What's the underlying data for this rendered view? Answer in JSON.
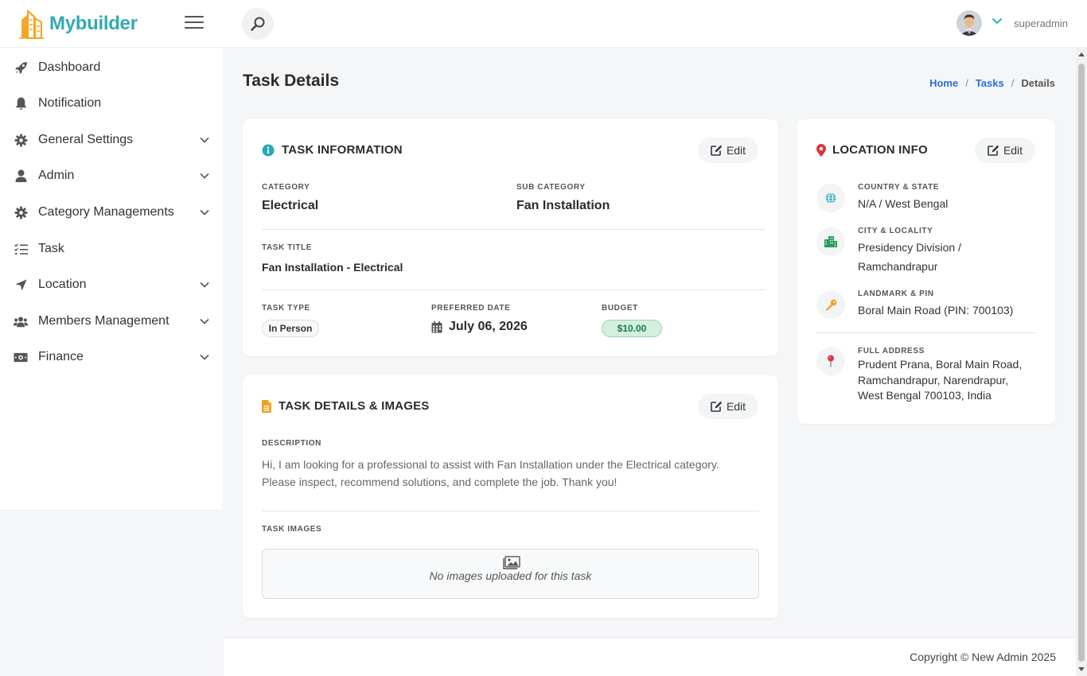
{
  "app": {
    "name": "Mybuilder"
  },
  "header": {
    "user_name": "superadmin"
  },
  "sidebar": {
    "items": [
      {
        "label": "Dashboard",
        "icon": "rocket-icon",
        "expandable": false
      },
      {
        "label": "Notification",
        "icon": "bell-icon",
        "expandable": false
      },
      {
        "label": "General Settings",
        "icon": "gear-icon",
        "expandable": true
      },
      {
        "label": "Admin",
        "icon": "user-icon",
        "expandable": true
      },
      {
        "label": "Category Managements",
        "icon": "gear-icon",
        "expandable": true
      },
      {
        "label": "Task",
        "icon": "task-list-icon",
        "expandable": false
      },
      {
        "label": "Location",
        "icon": "location-arrow-icon",
        "expandable": true
      },
      {
        "label": "Members Management",
        "icon": "users-icon",
        "expandable": true
      },
      {
        "label": "Finance",
        "icon": "money-icon",
        "expandable": true
      }
    ]
  },
  "page": {
    "title": "Task Details",
    "breadcrumb": {
      "home": "Home",
      "tasks": "Tasks",
      "current": "Details",
      "separator": "/"
    }
  },
  "task_info": {
    "title": "TASK INFORMATION",
    "edit_label": "Edit",
    "category_label": "CATEGORY",
    "category": "Electrical",
    "subcategory_label": "SUB CATEGORY",
    "subcategory": "Fan Installation",
    "task_title_label": "TASK TITLE",
    "task_title": "Fan Installation - Electrical",
    "task_type_label": "TASK TYPE",
    "task_type": "In Person",
    "preferred_date_label": "PREFERRED DATE",
    "preferred_date": "July 06, 2026",
    "budget_label": "BUDGET",
    "budget": "$10.00"
  },
  "task_details": {
    "title": "TASK DETAILS & IMAGES",
    "edit_label": "Edit",
    "description_label": "DESCRIPTION",
    "description_line1": "Hi, I am looking for a professional to assist with Fan Installation under the Electrical category.",
    "description_line2": "Please inspect, recommend solutions, and complete the job. Thank you!",
    "images_label": "TASK IMAGES",
    "no_images": "No images uploaded for this task"
  },
  "location": {
    "title": "LOCATION INFO",
    "edit_label": "Edit",
    "country_label": "COUNTRY & STATE",
    "country_value": "N/A / West Bengal",
    "city_label": "CITY & LOCALITY",
    "city_line1": "Presidency Division /",
    "city_line2": "Ramchandrapur",
    "landmark_label": "LANDMARK & PIN",
    "landmark_value": "Boral Main Road (PIN: 700103)",
    "address_label": "FULL ADDRESS",
    "address_line1": "Prudent Prana, Boral Main Road,",
    "address_line2": "Ramchandrapur, Narendrapur,",
    "address_line3": "West Bengal 700103, India"
  },
  "footer": {
    "copyright": "Copyright © New Admin 2025"
  },
  "colors": {
    "brand": "#33a9b3",
    "link": "#2a6fd6",
    "budget_bg": "#d3efdf",
    "budget_text": "#1f7a48",
    "info_icon": "#2ea8b8",
    "doc_icon": "#f0a020",
    "pin_icon": "#d9363e"
  }
}
